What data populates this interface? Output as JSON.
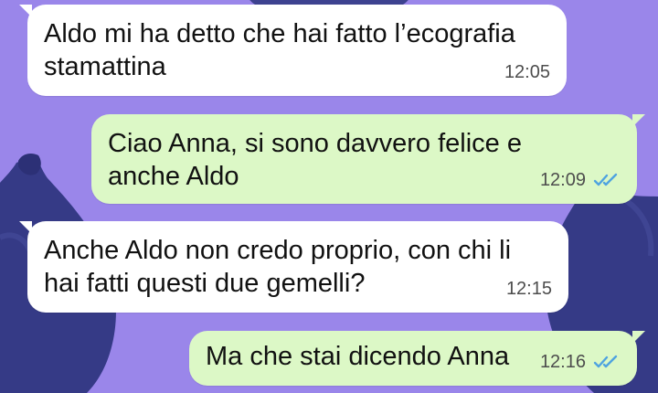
{
  "chat": {
    "messages": [
      {
        "direction": "incoming",
        "text": "Aldo mi ha detto che hai fatto l’ecografia\nstamattina",
        "time": "12:05"
      },
      {
        "direction": "outgoing",
        "text": "Ciao Anna, si sono davvero felice e\nanche Aldo",
        "time": "12:09",
        "status_icon": "double-check-icon"
      },
      {
        "direction": "incoming",
        "text": "Anche Aldo non credo proprio, con chi li\nhai fatti questi due gemelli?",
        "time": "12:15"
      },
      {
        "direction": "outgoing",
        "text": "Ma che stai dicendo Anna",
        "time": "12:16",
        "status_icon": "double-check-icon"
      }
    ]
  },
  "colors": {
    "wallpaper": "#9a86ea",
    "incoming_bubble": "#ffffff",
    "outgoing_bubble": "#dcf8c6",
    "read_tick": "#4fa3e0",
    "fig": "#3a3f86"
  }
}
